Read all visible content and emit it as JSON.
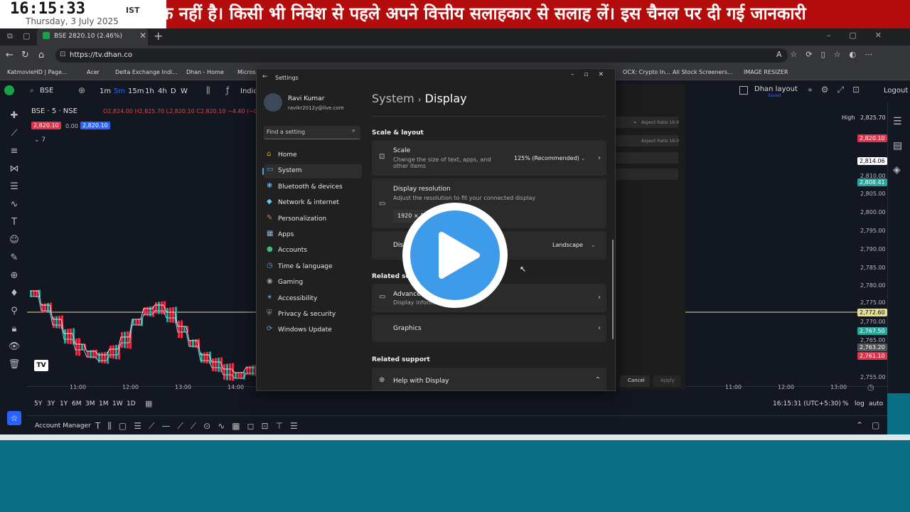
{
  "ticker": {
    "text": "क नहीं है। किसी भी निवेश से पहले अपने वित्तीय सलाहकार से सलाह लें। इस चैनल पर दी गई जानकारी",
    "time": "16:15:33",
    "tz": "IST",
    "date": "Thursday, 3 July 2025"
  },
  "browser": {
    "tab_title": "BSE 2820.10 (2.46%)",
    "url": "https://tv.dhan.co",
    "bookmarks": [
      "KatmovieHD | Page...",
      "Acer",
      "Delta Exchange Indi...",
      "Dhan - Home",
      "Microsc",
      "OCX: Crypto In...",
      "All Stock Screeners...",
      "IMAGE RESIZER"
    ]
  },
  "app": {
    "symbol": "BSE",
    "timeframes": [
      "1m",
      "5m",
      "15m",
      "1h",
      "4h",
      "D",
      "W"
    ],
    "indicators_label": "Indica",
    "layout_label": "Dhan layout",
    "layout_sub": "Saved",
    "logout": "Logout",
    "legend_symbol": "BSE · 5 · NSE",
    "legend_ohlc": "O2,824.00 H2,825.70 L2,820.10 C2,820.10 −4.40 (−0.1",
    "bid": "2,820.10",
    "spread": "0.00",
    "ask": "2,820.10",
    "indicator_count": "7",
    "high_label": "High",
    "prices": [
      "2,825.70",
      "2,820.10",
      "2,814.06",
      "2,810.00",
      "2,808.41",
      "2,805.00",
      "2,800.00",
      "2,795.00",
      "2,790.00",
      "2,785.00",
      "2,780.00",
      "2,775.00",
      "2,772.60",
      "2,770.00",
      "2,767.50",
      "2,765.00",
      "2,763.20",
      "2,761.10",
      "2,755.00"
    ],
    "time_ticks_left": [
      "11:00",
      "12:00",
      "13:00",
      "14:00"
    ],
    "time_ticks_right": [
      "11:00",
      "12:00",
      "13:00"
    ],
    "ranges": [
      "5Y",
      "3Y",
      "1Y",
      "6M",
      "3M",
      "1M",
      "1W",
      "1D"
    ],
    "clock": "16:15:31 (UTC+5:30)",
    "pct": "%",
    "log": "log",
    "auto": "auto",
    "account_manager": "Account Manager",
    "aspect1": "Aspect Ratio 16:9",
    "aspect2": "Aspect Ratio 16:0",
    "cancel": "Cancel",
    "apply": "Apply"
  },
  "settings": {
    "window_title": "Settings",
    "user_name": "Ravi Kumar",
    "user_email": "ravikr2012y@live.com",
    "search_placeholder": "Find a setting",
    "nav": [
      {
        "label": "Home",
        "color": "#e8a33c"
      },
      {
        "label": "System",
        "color": "#4aa3e6"
      },
      {
        "label": "Bluetooth & devices",
        "color": "#4aa3e6"
      },
      {
        "label": "Network & internet",
        "color": "#6fc3f0"
      },
      {
        "label": "Personalization",
        "color": "#e0734e"
      },
      {
        "label": "Apps",
        "color": "#8db4e6"
      },
      {
        "label": "Accounts",
        "color": "#3fbf7f"
      },
      {
        "label": "Time & language",
        "color": "#4aa3e6"
      },
      {
        "label": "Gaming",
        "color": "#9aa0a6"
      },
      {
        "label": "Accessibility",
        "color": "#4aa3e6"
      },
      {
        "label": "Privacy & security",
        "color": "#9aa0a6"
      },
      {
        "label": "Windows Update",
        "color": "#4aa3e6"
      }
    ],
    "breadcrumb_parent": "System",
    "breadcrumb_sep": "›",
    "breadcrumb_current": "Display",
    "section_scale": "Scale & layout",
    "scale_title": "Scale",
    "scale_sub": "Change the size of text, apps, and other items",
    "scale_value": "125% (Recommended)",
    "res_title": "Display resolution",
    "res_sub": "Adjust the resolution to fit your connected display",
    "res_value": "1920 × 10",
    "orient_title": "Disp",
    "orient_value": "Landscape",
    "section_related": "Related setti",
    "advanced_title": "Advanced",
    "advanced_sub": "Display informa",
    "graphics_title": "Graphics",
    "section_support": "Related support",
    "help_title": "Help with Display"
  }
}
